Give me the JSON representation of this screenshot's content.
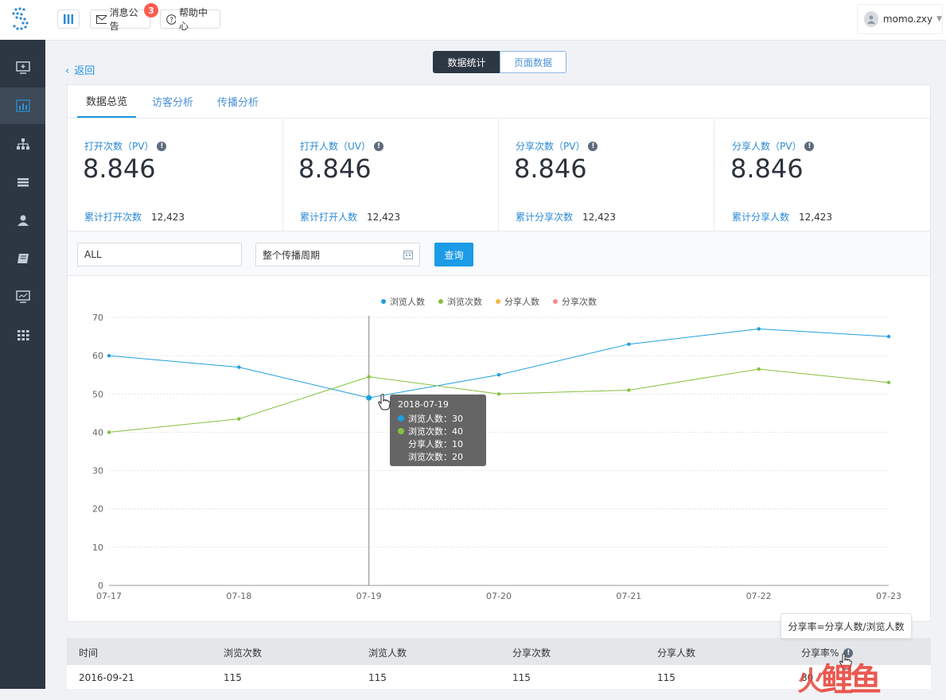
{
  "topbar": {
    "notice_label": "消息公告",
    "notice_count": "3",
    "help_label": "帮助中心",
    "user_name": "momo.zxy"
  },
  "sidebar": {
    "items": [
      "monitor-plus-icon",
      "bar-chart-icon",
      "sitemap-icon",
      "list-icon",
      "user-icon",
      "book-icon",
      "screen-chart-icon",
      "grid-icon"
    ],
    "active_index": 1
  },
  "back_label": "返回",
  "view_switch": {
    "stats_label": "数据统计",
    "page_label": "页面数据"
  },
  "tabs": [
    "数据总览",
    "访客分析",
    "传播分析"
  ],
  "stats": [
    {
      "label": "打开次数（PV）",
      "value": "8.846",
      "total_label": "累计打开次数",
      "total_value": "12,423"
    },
    {
      "label": "打开人数（UV）",
      "value": "8.846",
      "total_label": "累计打开人数",
      "total_value": "12,423"
    },
    {
      "label": "分享次数（PV）",
      "value": "8.846",
      "total_label": "累计分享次数",
      "total_value": "12,423"
    },
    {
      "label": "分享人数（PV）",
      "value": "8.846",
      "total_label": "累计分享人数",
      "total_value": "12,423"
    }
  ],
  "filter": {
    "scope_value": "ALL",
    "period_value": "整个传播周期",
    "query_label": "查询"
  },
  "chart_data": {
    "type": "line",
    "categories": [
      "07-17",
      "07-18",
      "07-19",
      "07-20",
      "07-21",
      "07-22",
      "07-23"
    ],
    "ylim": [
      0,
      70
    ],
    "yticks": [
      "0",
      "10",
      "20",
      "30",
      "40",
      "50",
      "60",
      "70"
    ],
    "legend_position": "top-center",
    "series": [
      {
        "name": "浏览人数",
        "color": "#1f9fdf",
        "values": [
          60,
          57,
          49,
          55,
          63,
          67,
          65
        ]
      },
      {
        "name": "浏览次数",
        "color": "#86c13e",
        "values": [
          40,
          43.5,
          54.5,
          50,
          51,
          56.5,
          53
        ]
      },
      {
        "name": "分享人数",
        "color": "#f4b73e",
        "values": []
      },
      {
        "name": "分享次数",
        "color": "#f08e8b",
        "values": []
      }
    ],
    "tooltip": {
      "date": "2018-07-19",
      "rows": [
        "浏览人数：30",
        "浏览次数：40",
        "分享人数：10",
        "浏览次数：20"
      ]
    },
    "grid": true
  },
  "table": {
    "headers": [
      "时间",
      "浏览次数",
      "浏览人数",
      "分享次数",
      "分享人数",
      "分享率%"
    ],
    "rows": [
      [
        "2016-09-21",
        "115",
        "115",
        "115",
        "115",
        "80"
      ]
    ]
  },
  "share_rate_tooltip": "分享率=分享人数/浏览人数",
  "watermark": "鲤鱼"
}
